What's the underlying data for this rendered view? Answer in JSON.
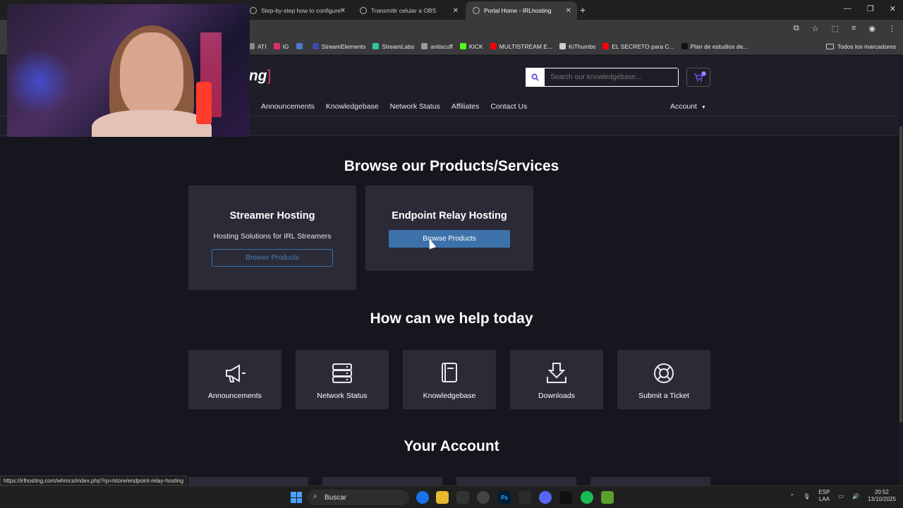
{
  "browser": {
    "tabs": [
      {
        "label": "Step-by-step how to configure",
        "active": false
      },
      {
        "label": "Transmitir celular a OBS",
        "active": false
      },
      {
        "label": "Portal Home - IRLhosting",
        "active": true
      }
    ],
    "bookmarks": [
      {
        "label": "ATI",
        "color": "#888888"
      },
      {
        "label": "IG",
        "color": "#e1306c"
      },
      {
        "label": "",
        "color": "#4a7ad0"
      },
      {
        "label": "StreamElements",
        "color": "#3b4ab0"
      },
      {
        "label": "StreamLabs",
        "color": "#31c3a2"
      },
      {
        "label": "antiscuff",
        "color": "#9a9a9a"
      },
      {
        "label": "KICK",
        "color": "#53fc18"
      },
      {
        "label": "MULTISTREAM E...",
        "color": "#ff0000"
      },
      {
        "label": "KiThumbs",
        "color": "#cccccc"
      },
      {
        "label": "EL SECRETO para C...",
        "color": "#ff0000"
      },
      {
        "label": "Plan de estudios de...",
        "color": "#111111"
      }
    ],
    "all_bookmarks": "Todos los marcadores",
    "status_url": "https://irlhosting.com/whmcs/index.php?rp=/store/endpoint-relay-hosting"
  },
  "site": {
    "logo_text": "ting",
    "logo_bracket": "]",
    "search_placeholder": "Search our knowledgebase...",
    "cart_count": "0",
    "nav": [
      "Announcements",
      "Knowledgebase",
      "Network Status",
      "Affiliates",
      "Contact Us"
    ],
    "account": "Account"
  },
  "products": {
    "heading": "Browse our Products/Services",
    "cards": [
      {
        "title": "Streamer Hosting",
        "desc": "Hosting Solutions for IRL Streamers",
        "button": "Browse Products"
      },
      {
        "title": "Endpoint Relay Hosting",
        "button": "Browse Products"
      }
    ]
  },
  "help": {
    "heading": "How can we help today",
    "items": [
      {
        "label": "Announcements",
        "icon": "megaphone-icon"
      },
      {
        "label": "Network Status",
        "icon": "server-icon"
      },
      {
        "label": "Knowledgebase",
        "icon": "book-icon"
      },
      {
        "label": "Downloads",
        "icon": "download-icon"
      },
      {
        "label": "Submit a Ticket",
        "icon": "lifebuoy-icon"
      }
    ]
  },
  "account_section": {
    "heading": "Your Account"
  },
  "taskbar": {
    "search_label": "Buscar",
    "lang_top": "ESP",
    "lang_bottom": "LAA",
    "time": "20:52",
    "date": "13/10/2025"
  },
  "colors": {
    "page_bg": "#15161e",
    "card_bg": "#2a2b37",
    "accent_blue": "#3d71aa",
    "logo_accent": "#e03b5a"
  }
}
